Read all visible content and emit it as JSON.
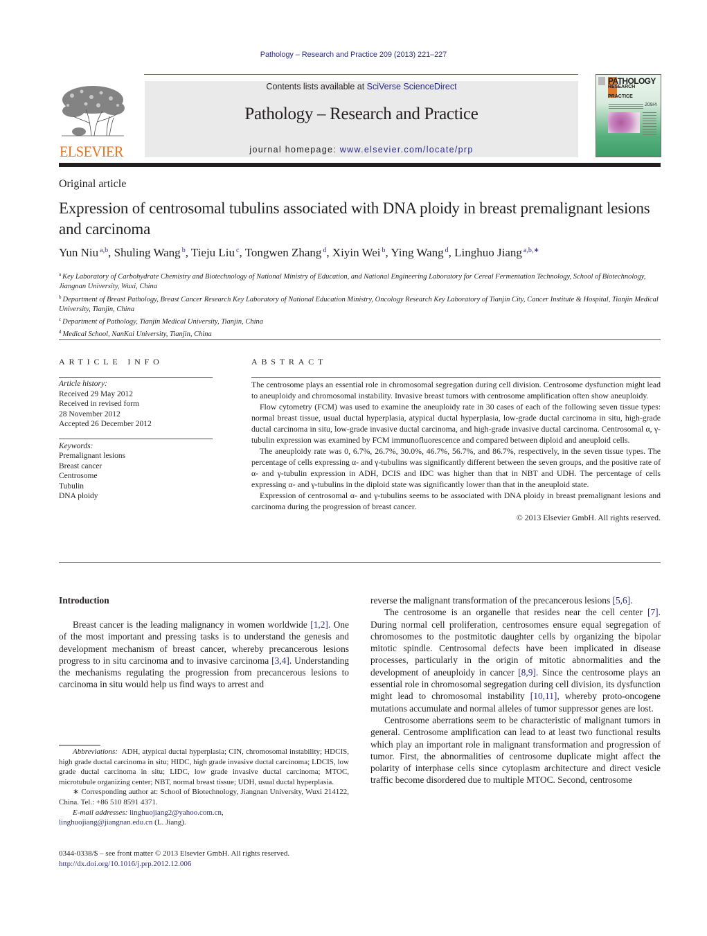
{
  "header": {
    "citation": "Pathology – Research and Practice 209 (2013) 221–227",
    "contents_prefix": "Contents lists available at ",
    "contents_link": "SciVerse ScienceDirect",
    "journal_title": "Pathology – Research and Practice",
    "homepage_prefix": "journal homepage: ",
    "homepage_link": "www.elsevier.com/locate/prp",
    "publisher_logo_text": "ELSEVIER",
    "cover": {
      "title_line1": "PATHOLOGY",
      "title_line2": "RESEARCH",
      "title_line3": "PRACTICE",
      "volume_mark": "209/4"
    }
  },
  "article": {
    "type": "Original article",
    "title": "Expression of centrosomal tubulins associated with DNA ploidy in breast premalignant lesions and carcinoma",
    "authors": [
      {
        "name": "Yun Niu",
        "sup": "a,b",
        "sep": ", "
      },
      {
        "name": "Shuling Wang",
        "sup": "b",
        "sep": ", "
      },
      {
        "name": "Tieju Liu",
        "sup": "c",
        "sep": ", "
      },
      {
        "name": "Tongwen Zhang",
        "sup": "d",
        "sep": ", "
      },
      {
        "name": "Xiyin Wei",
        "sup": "b",
        "sep": ", "
      },
      {
        "name": "Ying Wang",
        "sup": "d",
        "sep": ", "
      },
      {
        "name": "Linghuo Jiang",
        "sup": "a,b,∗",
        "sep": ""
      }
    ],
    "affiliations": [
      {
        "key": "a",
        "text": "Key Laboratory of Carbohydrate Chemistry and Biotechnology of National Ministry of Education, and National Engineering Laboratory for Cereal Fermentation Technology, School of Biotechnology, Jiangnan University, Wuxi, China"
      },
      {
        "key": "b",
        "text": "Department of Breast Pathology, Breast Cancer Research Key Laboratory of National Education Ministry, Oncology Research Key Laboratory of Tianjin City, Cancer Institute & Hospital, Tianjin Medical University, Tianjin, China"
      },
      {
        "key": "c",
        "text": "Department of Pathology, Tianjin Medical University, Tianjin, China"
      },
      {
        "key": "d",
        "text": "Medical School, NanKai University, Tianjin, China"
      }
    ]
  },
  "article_info": {
    "heading": "ARTICLE INFO",
    "history_label": "Article history:",
    "history": [
      "Received 29 May 2012",
      "Received in revised form",
      "28 November 2012",
      "Accepted 26 December 2012"
    ],
    "keywords_label": "Keywords:",
    "keywords": [
      "Premalignant lesions",
      "Breast cancer",
      "Centrosome",
      "Tubulin",
      "DNA ploidy"
    ]
  },
  "abstract": {
    "heading": "ABSTRACT",
    "paragraphs": [
      "The centrosome plays an essential role in chromosomal segregation during cell division. Centrosome dysfunction might lead to aneuploidy and chromosomal instability. Invasive breast tumors with centrosome amplification often show aneuploidy.",
      "Flow cytometry (FCM) was used to examine the aneuploidy rate in 30 cases of each of the following seven tissue types: normal breast tissue, usual ductal hyperplasia, atypical ductal hyperplasia, low-grade ductal carcinoma in situ, high-grade ductal carcinoma in situ, low-grade invasive ductal carcinoma, and high-grade invasive ductal carcinoma. Centrosomal α, γ-tubulin expression was examined by FCM immunofluorescence and compared between diploid and aneuploid cells.",
      "The aneuploidy rate was 0, 6.7%, 26.7%, 30.0%, 46.7%, 56.7%, and 86.7%, respectively, in the seven tissue types. The percentage of cells expressing α- and γ-tubulins was significantly different between the seven groups, and the positive rate of α- and γ-tubulin expression in ADH, DCIS and IDC was higher than that in NBT and UDH. The percentage of cells expressing α- and γ-tubulins in the diploid state was significantly lower than that in the aneuploid state.",
      "Expression of centrosomal α- and γ-tubulins seems to be associated with DNA ploidy in breast premalignant lesions and carcinoma during the progression of breast cancer."
    ],
    "copyright": "© 2013 Elsevier GmbH. All rights reserved."
  },
  "body": {
    "intro_heading": "Introduction",
    "left_paragraph": {
      "parts": [
        "Breast cancer is the leading malignancy in women worldwide ",
        "[1,2]",
        ". One of the most important and pressing tasks is to understand the genesis and development mechanism of breast cancer, whereby precancerous lesions progress to in situ carcinoma and to invasive carcinoma ",
        "[3,4]",
        ". Understanding the mechanisms regulating the progression from precancerous lesions to carcinoma in situ would help us find ways to arrest and"
      ]
    },
    "right_paragraphs": [
      {
        "parts": [
          "reverse the malignant transformation of the precancerous lesions ",
          "[5,6]",
          "."
        ]
      },
      {
        "parts": [
          "The centrosome is an organelle that resides near the cell center ",
          "[7]",
          ". During normal cell proliferation, centrosomes ensure equal segregation of chromosomes to the postmitotic daughter cells by organizing the bipolar mitotic spindle. Centrosomal defects have been implicated in disease processes, particularly in the origin of mitotic abnormalities and the development of aneuploidy in cancer ",
          "[8,9]",
          ". Since the centrosome plays an essential role in chromosomal segregation during cell division, its dysfunction might lead to chromosomal instability ",
          "[10,11]",
          ", whereby proto-oncogene mutations accumulate and normal alleles of tumor suppressor genes are lost."
        ]
      },
      {
        "parts": [
          "Centrosome aberrations seem to be characteristic of malignant tumors in general. Centrosome amplification can lead to at least two functional results which play an important role in malignant transformation and progression of tumor. First, the abnormalities of centrosome duplicate might affect the polarity of interphase cells since cytoplasm architecture and direct vesicle traffic become disordered due to multiple MTOC. Second, centrosome"
        ]
      }
    ]
  },
  "footnotes": {
    "abbreviations_label": "Abbreviations:",
    "abbreviations_text": "ADH, atypical ductal hyperplasia; CIN, chromosomal instability; HDCIS, high grade ductal carcinoma in situ; HIDC, high grade invasive ductal carcinoma; LDCIS, low grade ductal carcinoma in situ; LIDC, low grade invasive ductal carcinoma; MTOC, microtubule organizing center; NBT, normal breast tissue; UDH, usual ductal hyperplasia.",
    "corresponding": "∗ Corresponding author at: School of Biotechnology, Jiangnan University, Wuxi 214122, China. Tel.: +86 510 8591 4371.",
    "email_label": "E-mail addresses:",
    "email1": "linghuojiang2@yahoo.com.cn",
    "email_sep": ",",
    "email2": "linghuojiang@jiangnan.edu.cn",
    "email_suffix": " (L. Jiang).",
    "issn_line": "0344-0338/$ – see front matter © 2013 Elsevier GmbH. All rights reserved.",
    "doi": "http://dx.doi.org/10.1016/j.prp.2012.12.006"
  },
  "colors": {
    "link": "#2b2b8a",
    "elsevier_orange": "#e9711c",
    "masthead_grey": "#eaeaea",
    "text": "#231f20"
  }
}
